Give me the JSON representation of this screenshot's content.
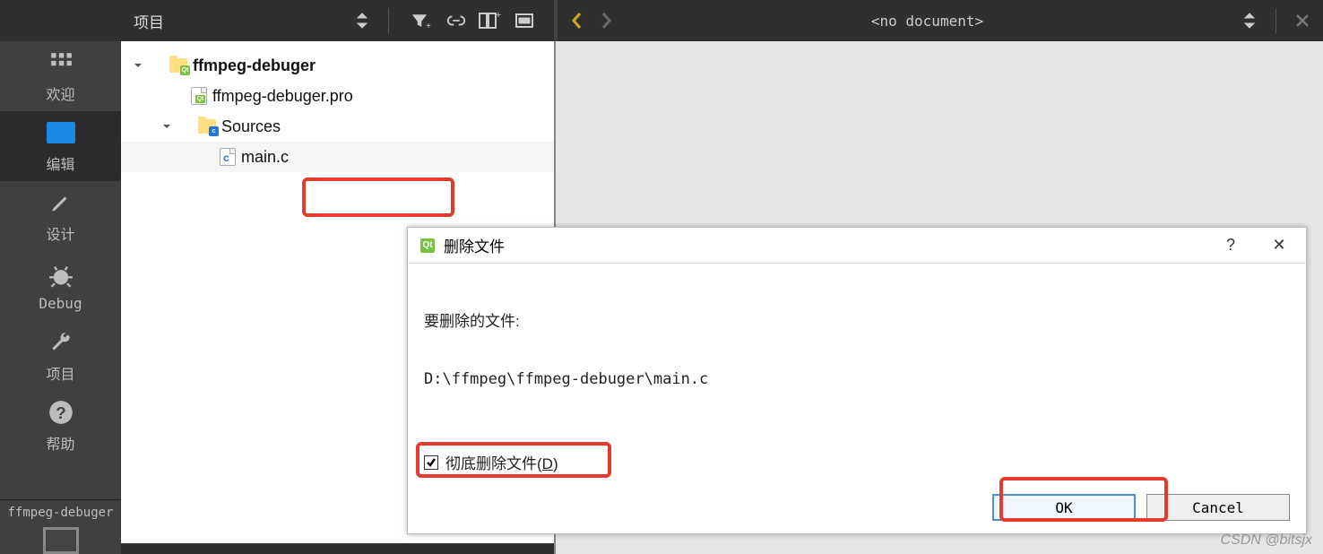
{
  "leftnav": {
    "welcome": "欢迎",
    "editor": "编辑",
    "design": "设计",
    "debug": "Debug",
    "projects": "项目",
    "help": "帮助",
    "kit": "ffmpeg-debuger"
  },
  "header": {
    "project_dropdown": "项目",
    "no_document": "<no document>"
  },
  "tree": {
    "root": "ffmpeg-debuger",
    "pro": "ffmpeg-debuger.pro",
    "sources": "Sources",
    "main": "main.c"
  },
  "dialog": {
    "title": "删除文件",
    "prompt": "要删除的文件:",
    "path": "D:\\ffmpeg\\ffmpeg-debuger\\main.c",
    "checkbox_prefix": "彻底删除文件(",
    "checkbox_hotkey": "D",
    "checkbox_suffix": ")",
    "ok": "OK",
    "cancel": "Cancel",
    "help": "?",
    "close": "✕"
  },
  "watermark": "CSDN @bitsjx"
}
